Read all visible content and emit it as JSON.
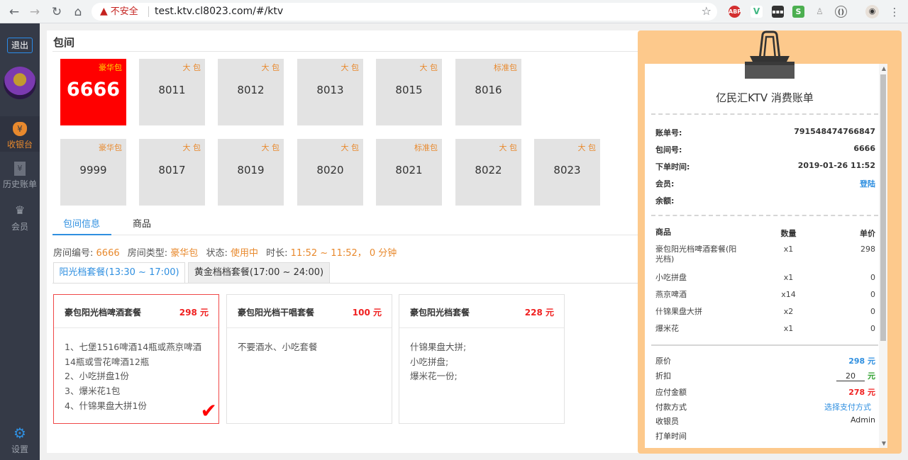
{
  "browser": {
    "back": "←",
    "forward": "→",
    "reload": "↻",
    "home": "⌂",
    "security_label": "不安全",
    "url": "test.ktv.cl8023.com/#/ktv",
    "star": "☆",
    "extensions": [
      "ABP",
      "V",
      "▪▪▪",
      "S",
      "♙",
      "()",
      "◉"
    ]
  },
  "sidebar": {
    "logout": "退出",
    "items": [
      {
        "label": "收银台",
        "icon": "money-bag-icon",
        "glyph": "¥"
      },
      {
        "label": "历史账单",
        "icon": "bill-icon",
        "glyph": "¥"
      },
      {
        "label": "会员",
        "icon": "crown-icon",
        "glyph": "♛"
      }
    ],
    "settings": {
      "label": "设置",
      "icon": "gear-icon",
      "glyph": "⚙"
    }
  },
  "main": {
    "title": "包间",
    "rooms": [
      {
        "type": "豪华包",
        "number": "6666",
        "selected": true
      },
      {
        "type": "大 包",
        "number": "8011"
      },
      {
        "type": "大 包",
        "number": "8012"
      },
      {
        "type": "大 包",
        "number": "8013"
      },
      {
        "type": "大 包",
        "number": "8015"
      },
      {
        "type": "标准包",
        "number": "8016"
      },
      {
        "type": "豪华包",
        "number": "9999"
      },
      {
        "type": "大 包",
        "number": "8017"
      },
      {
        "type": "大 包",
        "number": "8019"
      },
      {
        "type": "大 包",
        "number": "8020"
      },
      {
        "type": "标准包",
        "number": "8021"
      },
      {
        "type": "大 包",
        "number": "8022"
      },
      {
        "type": "大 包",
        "number": "8023"
      }
    ],
    "tabs": [
      {
        "label": "包间信息",
        "active": true
      },
      {
        "label": "商品",
        "active": false
      }
    ],
    "room_info": {
      "number_label": "房间编号:",
      "number": "6666",
      "type_label": "房间类型:",
      "type": "豪华包",
      "status_label": "状态:",
      "status": "使用中",
      "duration_label": "时长:",
      "duration": "11:52 ~ 11:52， 0 分钟"
    },
    "package_tabs": [
      {
        "label": "阳光档套餐(13:30 ~ 17:00)",
        "active": true
      },
      {
        "label": "黄金档档套餐(17:00 ~ 24:00)",
        "active": false
      }
    ],
    "packages": [
      {
        "name": "豪包阳光档啤酒套餐",
        "price": "298 元",
        "selected": true,
        "lines": [
          "1、七堡1516啤酒14瓶或燕京啤酒14瓶或雪花啤酒12瓶",
          "2、小吃拼盘1份",
          "3、爆米花1包",
          "4、什锦果盘大拼1份"
        ]
      },
      {
        "name": "豪包阳光档干唱套餐",
        "price": "100 元",
        "selected": false,
        "lines": [
          "不要酒水、小吃套餐"
        ]
      },
      {
        "name": "豪包阳光档套餐",
        "price": "228 元",
        "selected": false,
        "lines": [
          "什锦果盘大拼;",
          "小吃拼盘;",
          "爆米花一份;"
        ]
      }
    ]
  },
  "receipt": {
    "title": "亿民汇KTV 消费账单",
    "order_no_label": "账单号:",
    "order_no": "791548474766847",
    "room_label": "包间号:",
    "room": "6666",
    "time_label": "下单时间:",
    "time": "2019-01-26 11:52",
    "member_label": "会员:",
    "member_action": "登陆",
    "balance_label": "余额:",
    "col_item": "商品",
    "col_qty": "数量",
    "col_price": "单价",
    "items": [
      {
        "name": "豪包阳光档啤酒套餐(阳光档)",
        "qty": "x1",
        "price": "298"
      },
      {
        "name": "小吃拼盘",
        "qty": "x1",
        "price": "0"
      },
      {
        "name": "燕京啤酒",
        "qty": "x14",
        "price": "0"
      },
      {
        "name": "什锦果盘大拼",
        "qty": "x2",
        "price": "0"
      },
      {
        "name": "爆米花",
        "qty": "x1",
        "price": "0"
      }
    ],
    "original_label": "原价",
    "original": "298 元",
    "discount_label": "折扣",
    "discount_value": "20",
    "discount_unit": "元",
    "payable_label": "应付金额",
    "payable": "278 元",
    "pay_method_label": "付款方式",
    "pay_method_action": "选择支付方式",
    "cashier_label": "收银员",
    "cashier": "Admin",
    "print_time_label": "打单时间"
  }
}
